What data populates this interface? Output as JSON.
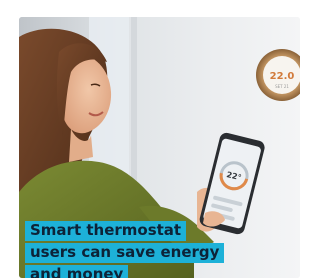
{
  "thermostat": {
    "temperature": "22.0",
    "set_label": "SET 21"
  },
  "phone": {
    "screen_temperature": "22°"
  },
  "caption": {
    "line1": "Smart thermostat",
    "line2": "users can save energy",
    "line3": "and money"
  },
  "colors": {
    "caption_background": "#1db1d8",
    "caption_text": "#0d2338",
    "thermostat_ring": "#b08455",
    "sweater": "#6c7a2a"
  }
}
